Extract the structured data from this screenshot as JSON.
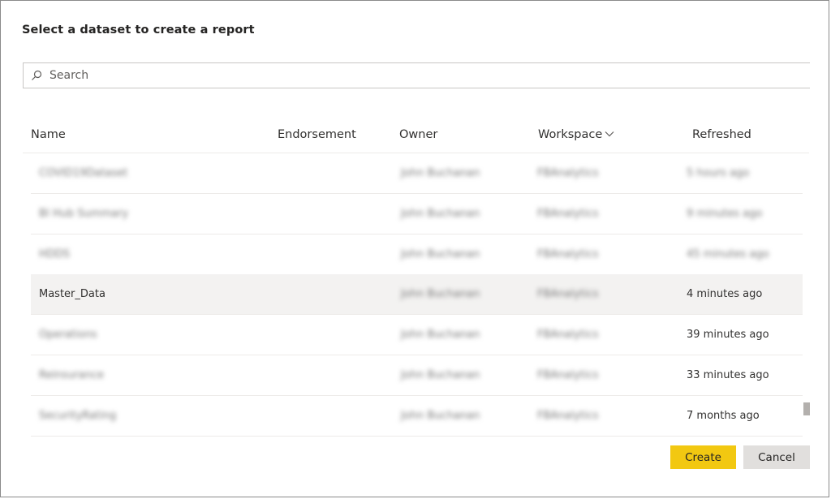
{
  "dialog": {
    "title": "Select a dataset to create a report",
    "search": {
      "placeholder": "Search",
      "value": ""
    },
    "columns": {
      "name": "Name",
      "endorsement": "Endorsement",
      "owner": "Owner",
      "workspace": "Workspace",
      "refreshed": "Refreshed"
    },
    "rows": [
      {
        "name": "COVID19Dataset",
        "endorsement": "",
        "owner": "John Buchanan",
        "workspace": "FBAnalytics",
        "refreshed": "5 hours ago",
        "redacted": true
      },
      {
        "name": "BI Hub Summary",
        "endorsement": "",
        "owner": "John Buchanan",
        "workspace": "FBAnalytics",
        "refreshed": "9 minutes ago",
        "redacted": true
      },
      {
        "name": "HDDS",
        "endorsement": "",
        "owner": "John Buchanan",
        "workspace": "FBAnalytics",
        "refreshed": "45 minutes ago",
        "redacted": true
      },
      {
        "name": "Master_Data",
        "endorsement": "",
        "owner": "John Buchanan",
        "workspace": "FBAnalytics",
        "refreshed": "4 minutes ago",
        "selected": true
      },
      {
        "name": "Operations",
        "endorsement": "",
        "owner": "John Buchanan",
        "workspace": "FBAnalytics",
        "refreshed": "39 minutes ago"
      },
      {
        "name": "Reinsurance",
        "endorsement": "",
        "owner": "John Buchanan",
        "workspace": "FBAnalytics",
        "refreshed": "33 minutes ago"
      },
      {
        "name": "SecurityRating",
        "endorsement": "",
        "owner": "John Buchanan",
        "workspace": "FBAnalytics",
        "refreshed": "7 months ago"
      }
    ],
    "buttons": {
      "create": "Create",
      "cancel": "Cancel"
    },
    "colors": {
      "primary": "#f2c811",
      "secondary": "#e1dfdd",
      "selected_row": "#f3f2f1"
    }
  }
}
